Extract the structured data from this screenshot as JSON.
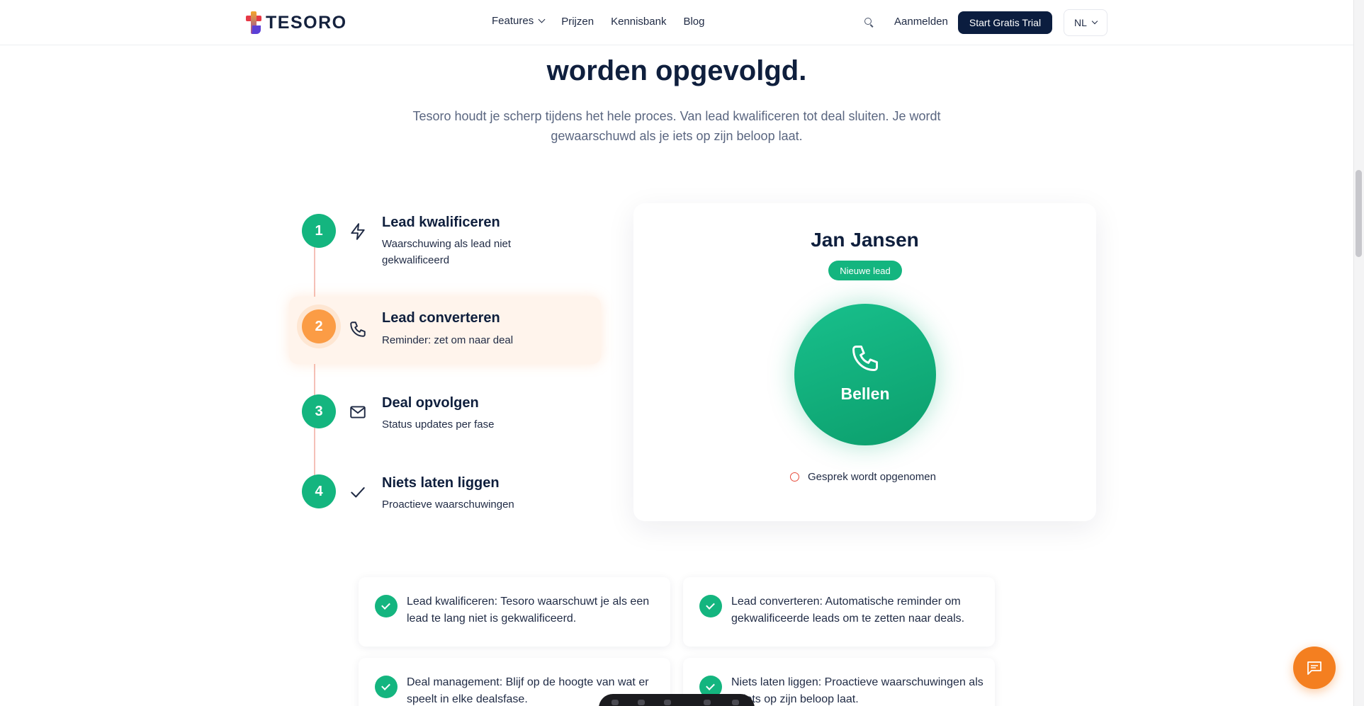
{
  "header": {
    "brand": "TESORO",
    "nav": [
      {
        "label": "Features",
        "has_dropdown": true
      },
      {
        "label": "Prijzen"
      },
      {
        "label": "Kennisbank"
      },
      {
        "label": "Blog"
      }
    ],
    "search_icon": "search-icon",
    "signin_label": "Aanmelden",
    "cta_label": "Start Gratis Trial",
    "language": "NL"
  },
  "hero": {
    "title": "worden opgevolgd.",
    "subtitle": "Tesoro houdt je scherp tijdens het hele proces. Van lead kwalificeren tot deal sluiten. Je wordt gewaarschuwd als je iets op zijn beloop laat."
  },
  "steps": [
    {
      "number": "1",
      "icon": "lightning-icon",
      "title": "Lead kwalificeren",
      "desc": "Waarschuwing als lead niet gekwalificeerd",
      "active": false
    },
    {
      "number": "2",
      "icon": "phone-icon",
      "title": "Lead converteren",
      "desc": "Reminder: zet om naar deal",
      "active": true
    },
    {
      "number": "3",
      "icon": "mail-icon",
      "title": "Deal opvolgen",
      "desc": "Status updates per fase",
      "active": false
    },
    {
      "number": "4",
      "icon": "check-icon",
      "title": "Niets laten liggen",
      "desc": "Proactieve waarschuwingen",
      "active": false
    }
  ],
  "call_card": {
    "name": "Jan Jansen",
    "badge": "Nieuwe lead",
    "button_label": "Bellen",
    "recording_text": "Gesprek wordt opgenomen"
  },
  "features": [
    {
      "text": "Lead kwalificeren: Tesoro waarschuwt je als een lead te lang niet is gekwalificeerd."
    },
    {
      "text": "Lead converteren: Automatische reminder om gekwalificeerde leads om te zetten naar deals."
    },
    {
      "text": "Deal management: Blijf op de hoogte van wat er speelt in elke dealsfase."
    },
    {
      "text": "Niets laten liggen: Proactieve waarschuwingen als je iets op zijn beloop laat."
    }
  ],
  "colors": {
    "accent_green": "#14b57f",
    "accent_orange": "#fb9c45",
    "navy": "#0b1d3f",
    "chat_orange": "#f47f20"
  }
}
